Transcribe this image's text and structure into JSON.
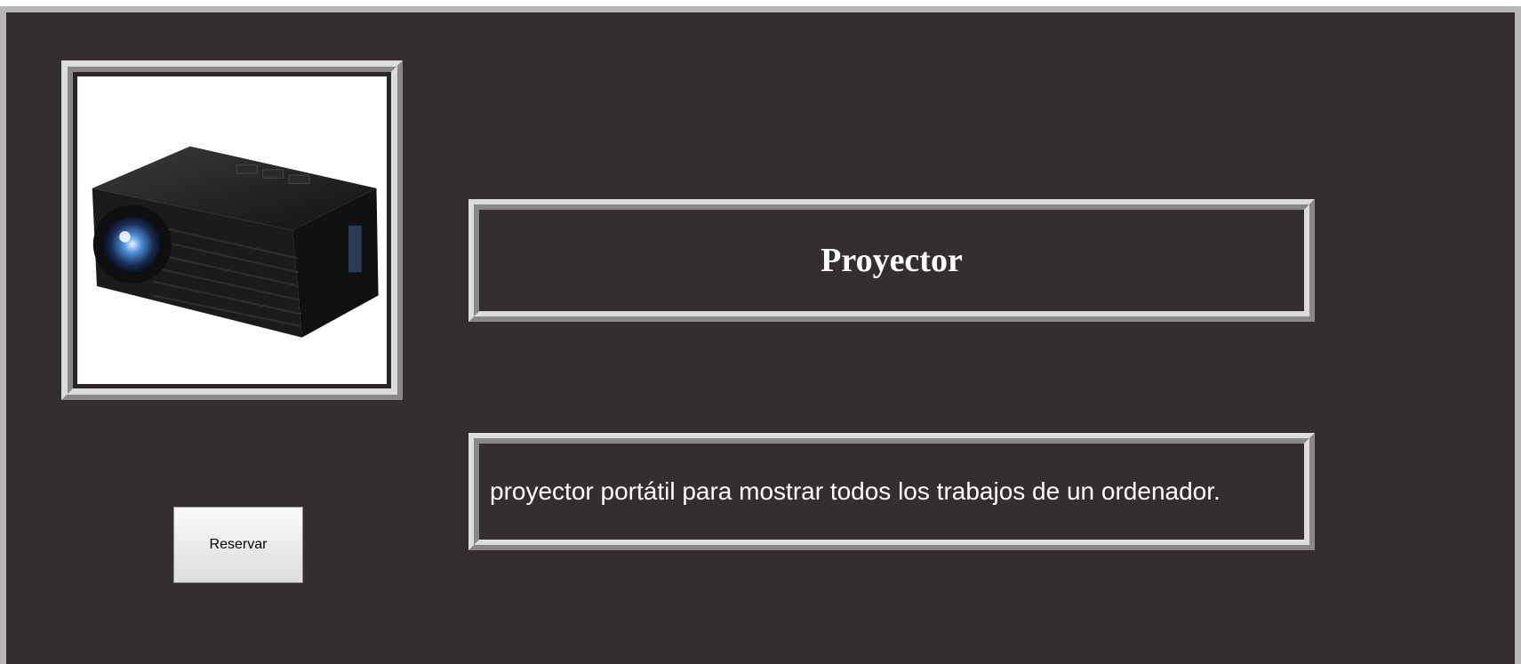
{
  "product": {
    "title": "Proyector",
    "description": "proyector portátil para mostrar todos los trabajos de un ordenador.",
    "image": "projector-photo"
  },
  "actions": {
    "reserve_label": "Reservar"
  },
  "colors": {
    "panel_background": "#342e2e",
    "frame_light": "#dcdcdc",
    "text": "#ffffff"
  }
}
